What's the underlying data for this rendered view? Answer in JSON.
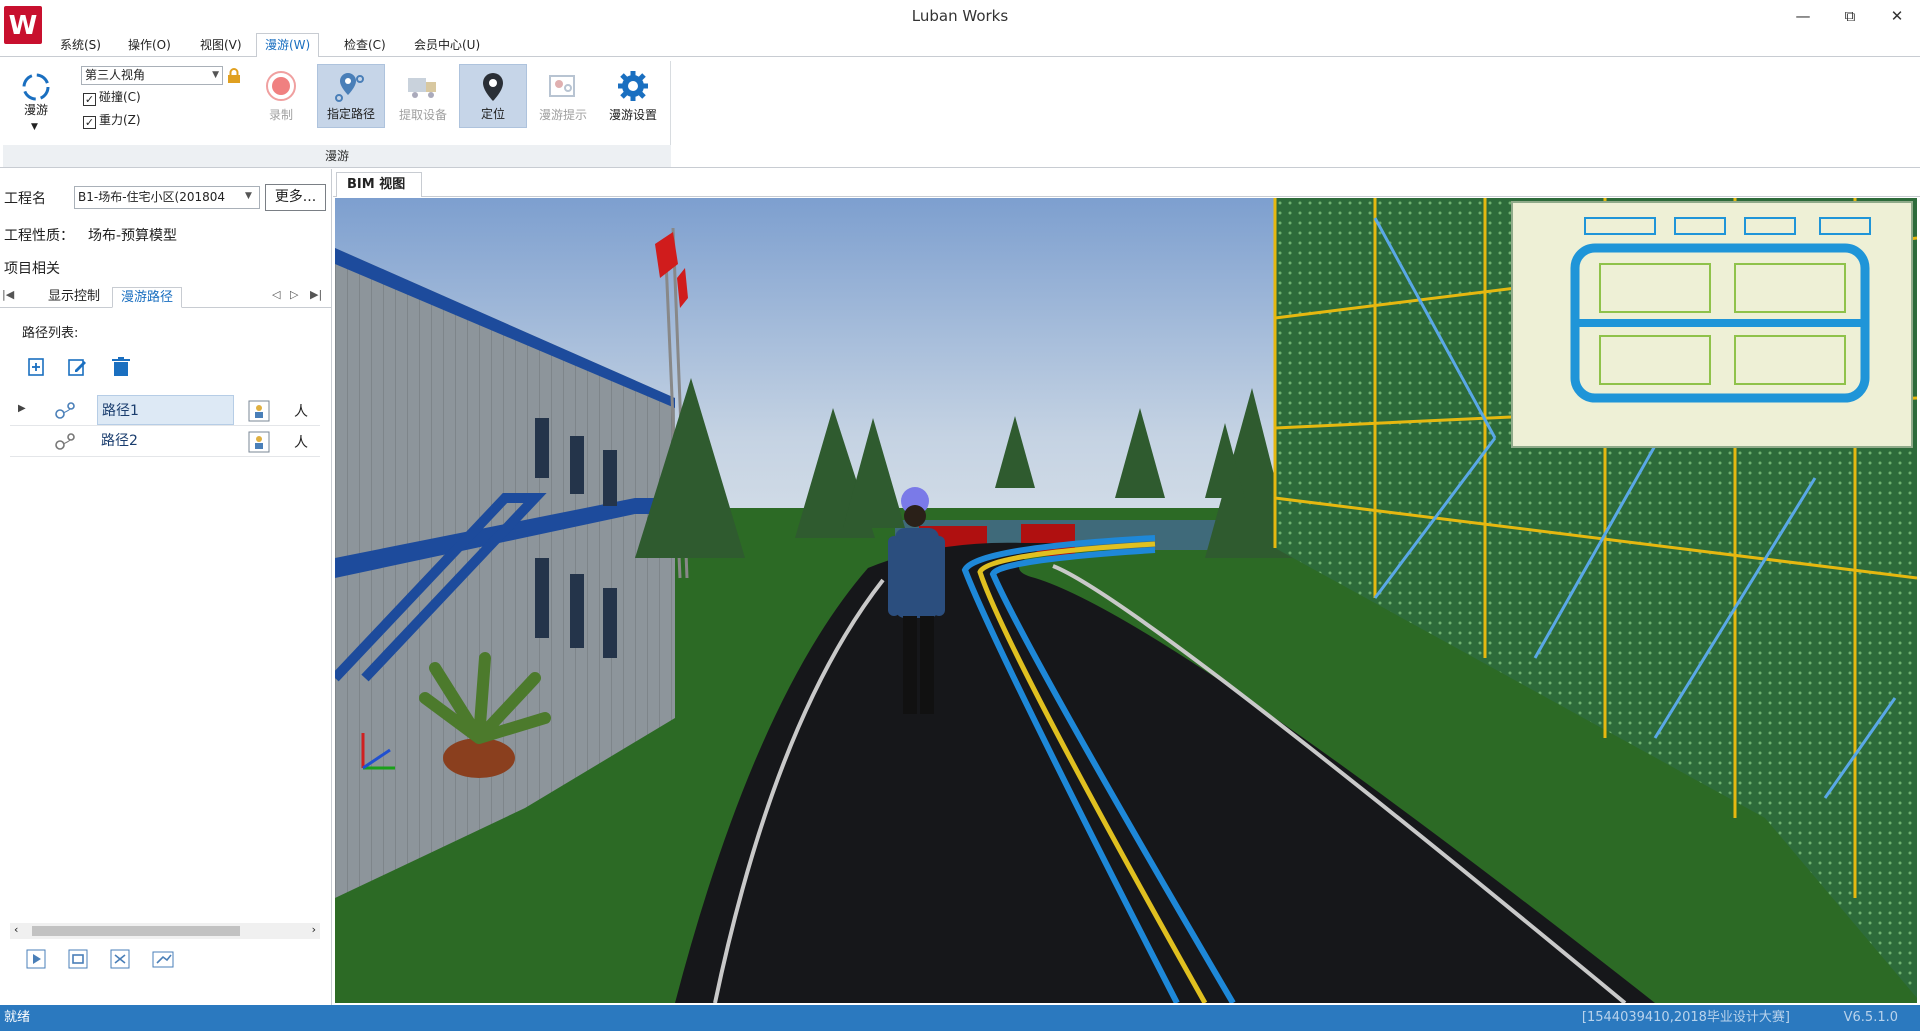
{
  "app": {
    "title": "Luban Works",
    "logo_letter": "W",
    "window_controls": [
      "—",
      "⧉",
      "✕"
    ]
  },
  "menu": {
    "items": [
      "系统(S)",
      "操作(O)",
      "视图(V)",
      "漫游(W)",
      "检查(C)",
      "会员中心(U)"
    ],
    "active": "漫游(W)"
  },
  "ribbon": {
    "roam_label": "漫游",
    "view_mode": "第三人视角",
    "collision_label": "碰撞(C)",
    "collision_checked": true,
    "gravity_label": "重力(Z)",
    "gravity_checked": true,
    "record_label": "录制",
    "assign_path_label": "指定路径",
    "extract_device_label": "提取设备",
    "locate_label": "定位",
    "roam_tip_label": "漫游提示",
    "roam_settings_label": "漫游设置",
    "group_label": "漫游",
    "colors": {
      "selected_bg": "#c6d5e8",
      "icon_blue": "#1a6fc0",
      "record_red": "#e05050"
    }
  },
  "left_panel": {
    "project_name_label": "工程名",
    "project_name_value": "B1-场布-住宅小区(201804",
    "more_button": "更多...",
    "project_type_label": "工程性质：",
    "project_type_value": "场布-预算模型",
    "project_related_label": "项目相关",
    "tabs": [
      "显示控制",
      "漫游路径"
    ],
    "active_tab": "漫游路径",
    "path_list_title": "路径列表:",
    "paths": [
      {
        "name": "路径1",
        "extra": "人"
      },
      {
        "name": "路径2",
        "extra": "人"
      }
    ]
  },
  "viewport": {
    "tab_label": "BIM 视图"
  },
  "status": {
    "left": "就绪",
    "middle": "[1544039410,2018毕业设计大赛]",
    "version": "V6.5.1.0",
    "bar_color": "#2b79bf"
  }
}
